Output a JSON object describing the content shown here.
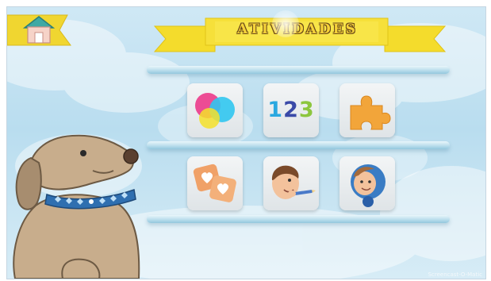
{
  "header": {
    "title": "ATIVIDADES"
  },
  "navigation": {
    "home_icon": "house-icon"
  },
  "activities": {
    "colors_icon": "color-circles-icon",
    "numbers_text": "123",
    "puzzle_icon": "puzzle-piece-icon",
    "memory_icon": "heart-cards-icon",
    "drawing_icon": "boy-with-pencil-icon",
    "face_icon": "boy-face-icon"
  },
  "mascot": {
    "icon": "dog-icon"
  },
  "watermark": "Screencast-O-Matic",
  "colors": {
    "banner": "#f4dc2c",
    "title_fill": "#f6d23a",
    "home_tab": "#f0d630",
    "home_roof": "#3fa9a4",
    "shelf": "#b7dceb",
    "background": "#c6e4f3",
    "dog_fur": "#c8ad8c",
    "collar": "#2f6fb0"
  }
}
